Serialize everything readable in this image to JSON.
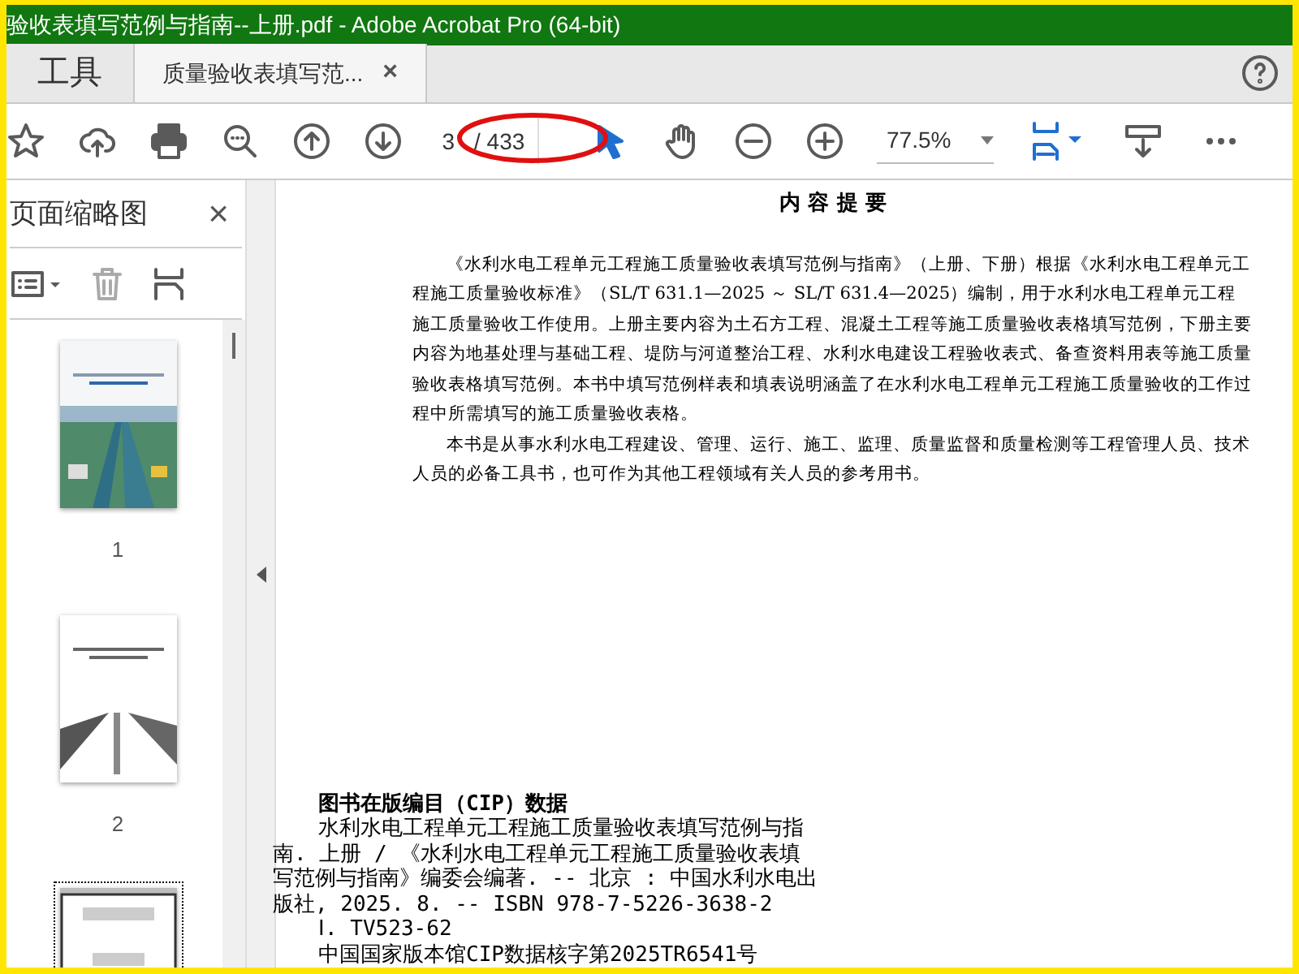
{
  "window": {
    "title": "验收表填写范例与指南--上册.pdf - Adobe Acrobat Pro (64-bit)"
  },
  "tabs": [
    {
      "label": "工具",
      "selected": false
    },
    {
      "label": "质量验收表填写范...",
      "selected": true,
      "close": "×"
    }
  ],
  "toolbar": {
    "page": {
      "value": "3",
      "total": "/ 433"
    },
    "zoom": {
      "value": "77.5%"
    }
  },
  "sidebar": {
    "title": "页面缩略图",
    "close": "×",
    "thumbnails": [
      {
        "label": "1",
        "selected": false,
        "kind": "cover"
      },
      {
        "label": "2",
        "selected": false,
        "kind": "sketch"
      },
      {
        "selected": true,
        "kind": "text"
      }
    ]
  },
  "document": {
    "heading": "内 容 提 要",
    "paragraphs": [
      "《水利水电工程单元工程施工质量验收表填写范例与指南》（上册、下册）根据《水利水电工程单元工程施工质量验收标准》（SL/T 631.1—2025 ～ SL/T 631.4—2025）编制，用于水利水电工程单元工程施工质量验收工作使用。上册主要内容为土石方工程、混凝土工程等施工质量验收表格填写范例，下册主要内容为地基处理与基础工程、堤防与河道整治工程、水利水电建设工程验收表式、备查资料用表等施工质量验收表格填写范例。本书中填写范例样表和填表说明涵盖了在水利水电工程单元工程施工质量验收的工作过程中所需填写的施工质量验收表格。",
      "本书是从事水利水电工程建设、管理、运行、施工、监理、质量监督和质量检测等工程管理人员、技术人员的必备工具书，也可作为其他工程领域有关人员的参考用书。"
    ],
    "cip": [
      {
        "text": "图书在版编目（CIP）数据",
        "kind": "heading"
      },
      {
        "text": "水利水电工程单元工程施工质量验收表填写范例与指",
        "kind": "indent"
      },
      {
        "text": "南. 上册 / 《水利水电工程单元工程施工质量验收表填",
        "kind": "plain"
      },
      {
        "text": "写范例与指南》编委会编著. -- 北京 : 中国水利水电出",
        "kind": "plain"
      },
      {
        "text": "版社, 2025. 8. -- ISBN 978-7-5226-3638-2",
        "kind": "plain"
      },
      {
        "text": "Ⅰ. TV523-62",
        "kind": "indent"
      },
      {
        "text": "中国国家版本馆CIP数据核字第2025TR6541号",
        "kind": "indent"
      }
    ]
  }
}
